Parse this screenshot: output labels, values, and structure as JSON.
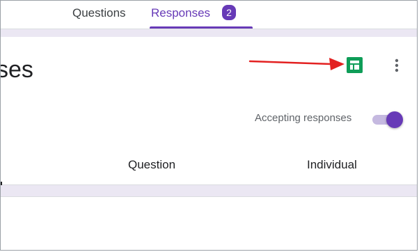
{
  "tabs": {
    "questions_label": "Questions",
    "responses_label": "Responses",
    "responses_count": "2",
    "active": "Responses"
  },
  "card": {
    "title_visible_fragment": "ses",
    "accepting_label": "Accepting responses",
    "accepting_enabled": true,
    "view_tabs": {
      "question_label": "Question",
      "individual_label": "Individual"
    }
  },
  "icons": {
    "sheets": "google-sheets-icon",
    "more": "more-vert-icon",
    "arrow": "red-arrow-annotation"
  },
  "colors": {
    "accent": "#673ab7",
    "accent_light": "#c5b9e0",
    "band": "#ebe7f3",
    "sheets_green": "#0f9d58",
    "arrow_red": "#e32020"
  }
}
